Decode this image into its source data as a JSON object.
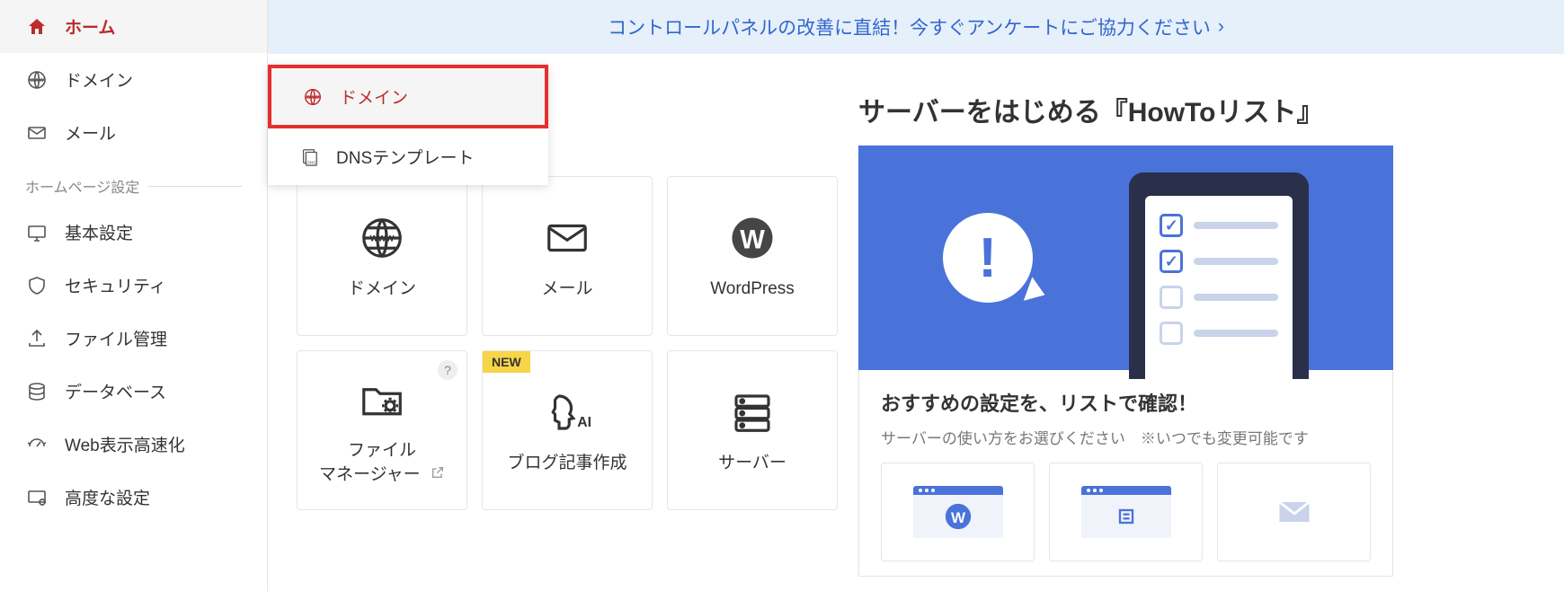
{
  "banner": {
    "text": "コントロールパネルの改善に直結！今すぐアンケートにご協力ください"
  },
  "sidebar": {
    "items": [
      {
        "label": "ホーム"
      },
      {
        "label": "ドメイン"
      },
      {
        "label": "メール"
      }
    ],
    "section_homepage": "ホームページ設定",
    "hp_items": [
      {
        "label": "基本設定"
      },
      {
        "label": "セキュリティ"
      },
      {
        "label": "ファイル管理"
      },
      {
        "label": "データベース"
      },
      {
        "label": "Web表示高速化"
      },
      {
        "label": "高度な設定"
      }
    ]
  },
  "submenu": {
    "items": [
      {
        "label": "ドメイン"
      },
      {
        "label": "DNSテンプレート"
      }
    ]
  },
  "cards": [
    {
      "label": "ドメイン"
    },
    {
      "label": "メール"
    },
    {
      "label": "WordPress"
    },
    {
      "label": "ファイル\nマネージャー",
      "help": "?",
      "external": true
    },
    {
      "label": "ブログ記事作成",
      "badge": "NEW"
    },
    {
      "label": "サーバー"
    }
  ],
  "howto": {
    "title": "サーバーをはじめる『HowToリスト』",
    "sub1": "おすすめの設定を、リストで確認！",
    "sub2": "サーバーの使い方をお選びください　※いつでも変更可能です"
  }
}
